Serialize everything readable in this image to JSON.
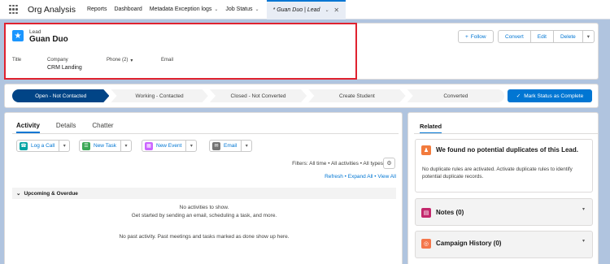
{
  "nav": {
    "app_name": "Org Analysis",
    "items": [
      {
        "label": "Reports",
        "has_menu": false
      },
      {
        "label": "Dashboard",
        "has_menu": false
      },
      {
        "label": "Metadata Exception logs",
        "has_menu": true
      },
      {
        "label": "Job Status",
        "has_menu": true
      }
    ],
    "active_tab": {
      "label": "* Guan Duo | Lead"
    }
  },
  "record": {
    "type_label": "Lead",
    "name": "Guan Duo",
    "icon": "star-icon",
    "buttons": {
      "follow": "Follow",
      "convert": "Convert",
      "edit": "Edit",
      "delete": "Delete"
    },
    "fields": {
      "title_label": "Title",
      "company_label": "Company",
      "company_value": "CRM Landing",
      "phone_label": "Phone (2)",
      "email_label": "Email"
    }
  },
  "path": {
    "stages": [
      "Open - Not Contacted",
      "Working - Contacted",
      "Closed - Not Converted",
      "Create Student",
      "Converted"
    ],
    "current_index": 0,
    "mark_button": "Mark Status as Complete"
  },
  "activity": {
    "tabs": [
      "Activity",
      "Details",
      "Chatter"
    ],
    "active_tab_index": 0,
    "buttons": {
      "log_call": "Log a Call",
      "new_task": "New Task",
      "new_event": "New Event",
      "email": "Email"
    },
    "filters": "Filters: All time • All activities • All types",
    "links": {
      "refresh": "Refresh",
      "expand_all": "Expand All",
      "view_all": "View All"
    },
    "upcoming_header": "Upcoming & Overdue",
    "no_activities": "No activities to show.",
    "get_started": "Get started by sending an email, scheduling a task, and more.",
    "no_past": "No past activity. Past meetings and tasks marked as done show up here."
  },
  "related": {
    "tab": "Related",
    "duplicates_title": "We found no potential duplicates of this Lead.",
    "duplicates_desc": "No duplicate rules are activated. Activate duplicate rules to identify potential duplicate records.",
    "notes_title": "Notes (0)",
    "campaign_title": "Campaign History (0)"
  },
  "colors": {
    "brand": "#0176d3",
    "path_current": "#014486",
    "highlight": "#e0222f",
    "log_call": "#00a3a3",
    "new_task": "#3ba755",
    "new_event": "#cb65ff",
    "email": "#747474",
    "duplicates": "#f27b3d",
    "notes": "#c3286c",
    "campaign": "#f4764b"
  }
}
